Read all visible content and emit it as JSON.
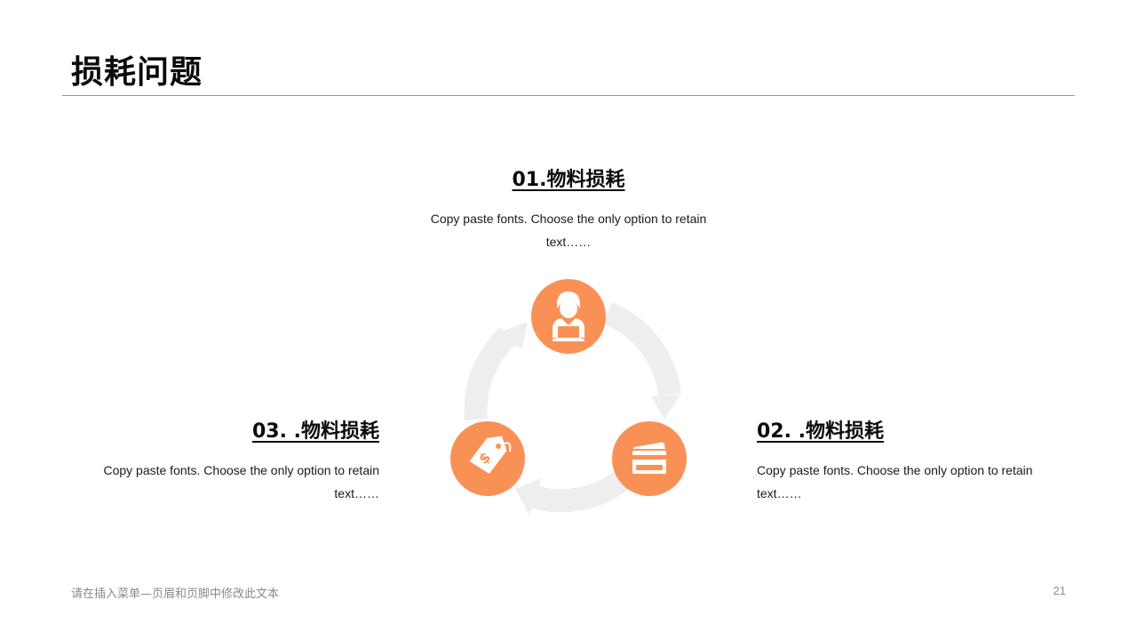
{
  "slide": {
    "title": "损耗问题",
    "page_number": "21",
    "footer": "请在插入菜单—页眉和页脚中修改此文本"
  },
  "items": [
    {
      "heading": "01.物料损耗",
      "text": "Copy paste fonts. Choose the only option to retain text……",
      "icon": "person-laptop-icon"
    },
    {
      "heading": "02. .物料损耗",
      "text": "Copy paste fonts. Choose the only option to retain text……",
      "icon": "credit-card-icon"
    },
    {
      "heading": "03. .物料损耗",
      "text": "Copy paste fonts. Choose the only option to retain text……",
      "icon": "price-tag-icon"
    }
  ],
  "colors": {
    "accent": "#F99156",
    "arrow": "#EEEEEE",
    "rule": "#9A9A9A",
    "footer": "#8A8A8A"
  }
}
